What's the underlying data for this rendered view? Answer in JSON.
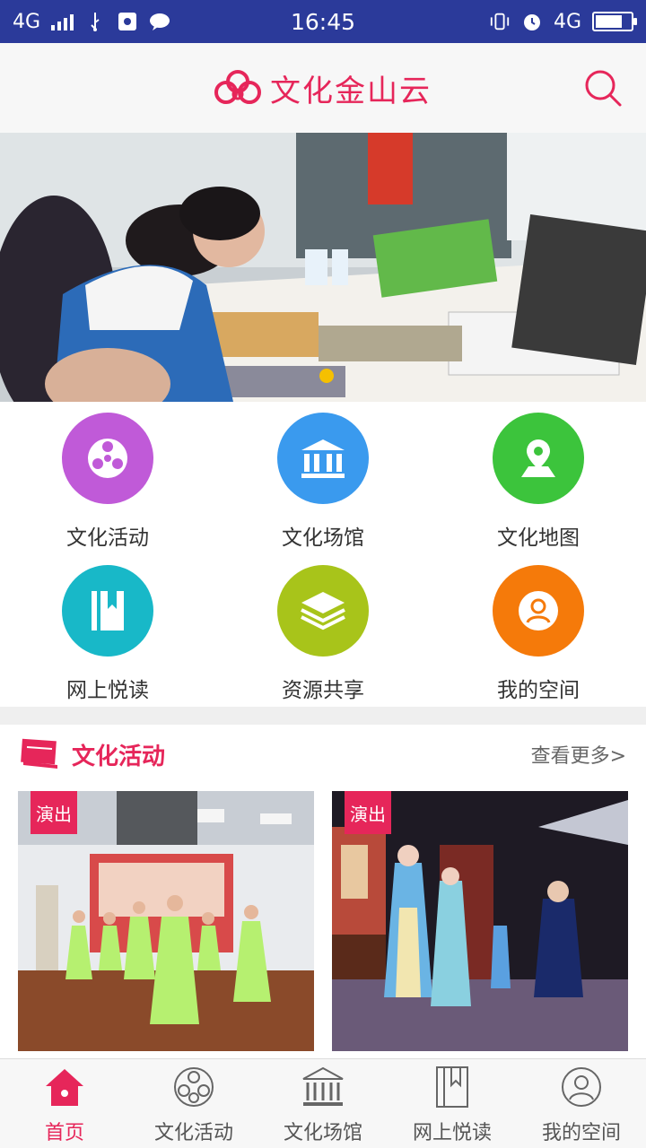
{
  "status_bar": {
    "network_left": "4G",
    "time": "16:45",
    "network_right": "4G"
  },
  "header": {
    "app_title": "文化金山云",
    "brand_color": "#e6265a"
  },
  "banner": {
    "slide_count_shown": 1
  },
  "features": [
    {
      "label": "文化活动",
      "icon": "film-reel-icon",
      "color": "#c05ad8"
    },
    {
      "label": "文化场馆",
      "icon": "museum-icon",
      "color": "#3a9aee"
    },
    {
      "label": "文化地图",
      "icon": "map-pin-icon",
      "color": "#3cc43c"
    },
    {
      "label": "网上悦读",
      "icon": "book-icon",
      "color": "#18b8c8"
    },
    {
      "label": "资源共享",
      "icon": "layers-icon",
      "color": "#a8c41a"
    },
    {
      "label": "我的空间",
      "icon": "user-icon",
      "color": "#f57a0a"
    }
  ],
  "section": {
    "title": "文化活动",
    "more": "查看更多>"
  },
  "cards": [
    {
      "tag": "演出"
    },
    {
      "tag": "演出"
    }
  ],
  "bottom_nav": [
    {
      "label": "首页",
      "icon": "home-icon",
      "active": true
    },
    {
      "label": "文化活动",
      "icon": "film-reel-icon",
      "active": false
    },
    {
      "label": "文化场馆",
      "icon": "museum-icon",
      "active": false
    },
    {
      "label": "网上悦读",
      "icon": "book-icon",
      "active": false
    },
    {
      "label": "我的空间",
      "icon": "user-icon",
      "active": false
    }
  ]
}
